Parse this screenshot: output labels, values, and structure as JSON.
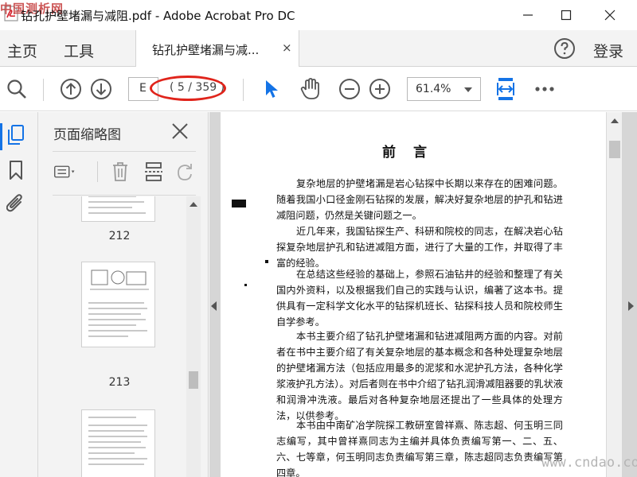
{
  "window": {
    "title": "钻孔护壁堵漏与减阻.pdf - Adobe Acrobat Pro DC",
    "watermark_top": "中国测析网",
    "watermark_bottom": "www.cndao.com"
  },
  "menu": {
    "home": "主页",
    "tools": "工具",
    "login": "登录"
  },
  "tab": {
    "label": "钻孔护壁堵漏与减...",
    "close": "×"
  },
  "toolbar": {
    "page_input_value": "E",
    "page_count": "( 5 / 359 )",
    "zoom_value": "61.4%"
  },
  "thumbnails_panel": {
    "title": "页面缩略图",
    "pages": [
      {
        "label": "212"
      },
      {
        "label": "213"
      },
      {
        "label": ""
      }
    ]
  },
  "document": {
    "heading": "前言",
    "paragraphs": [
      "复杂地层的护壁堵漏是岩心钻探中长期以来存在的困难问题。随着我国小口径金刚石钻探的发展，解决好复杂地层的护孔和钻进减阻问题，仍然是关键问题之一。",
      "近几年来，我国钻探生产、科研和院校的同志，在解决岩心钻探复杂地层护孔和钻进减阻方面，进行了大量的工作，并取得了丰富的经验。",
      "在总结这些经验的基础上，参照石油钻井的经验和整理了有关国内外资料，以及根据我们自己的实践与认识，编著了这本书。提供具有一定科学文化水平的钻探机班长、钻探科技人员和院校师生自学参考。",
      "本书主要介绍了钻孔护壁堵漏和钻进减阻两方面的内容。对前者在书中主要介绍了有关复杂地层的基本概念和各种处理复杂地层的护壁堵漏方法（包括应用最多的泥浆和水泥护孔方法，各种化学浆液护孔方法）。对后者则在书中介绍了钻孔润滑减阻器要的乳状液和润滑冲洗液。最后对各种复杂地层还提出了一些具体的处理方法，以供参考。",
      "本书由中南矿冶学院探工教研室曾祥熹、陈志超、何玉明三同志编写，其中曾祥熹同志为主编并具体负责编写第一、二、五、六、七等章，何玉明同志负责编写第三章，陈志超同志负责编写第四章。"
    ]
  },
  "colors": {
    "accent": "#1473e6",
    "annotation": "#e0241b",
    "panel_bg": "#f3f3f3",
    "doc_bg": "#d6d6d6"
  },
  "icons": {
    "window": [
      "acrobat-logo-icon",
      "minimize-icon",
      "maximize-icon",
      "close-icon"
    ],
    "toolbar": [
      "search-icon",
      "previous-page-icon",
      "next-page-icon",
      "select-cursor-icon",
      "hand-icon",
      "zoom-out-icon",
      "zoom-in-icon",
      "fit-width-icon",
      "more-icon"
    ],
    "rail": [
      "page-thumbnails-icon",
      "bookmarks-icon",
      "attachments-icon"
    ],
    "panel": [
      "thumbnail-options-icon",
      "delete-page-icon",
      "insert-page-icon",
      "rotate-page-icon",
      "close-panel-icon"
    ]
  }
}
